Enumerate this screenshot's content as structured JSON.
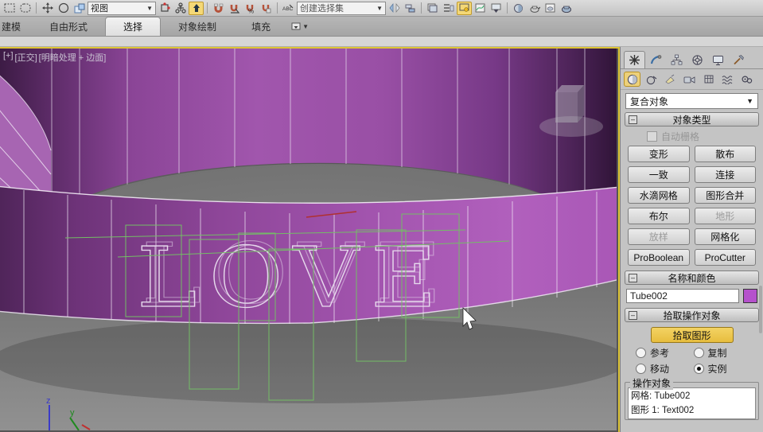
{
  "toolbar": {
    "view_dropdown": "视图",
    "selection_set_placeholder": "创建选择集"
  },
  "ribbon": {
    "tabs": [
      {
        "label": "建模"
      },
      {
        "label": "自由形式"
      },
      {
        "label": "选择",
        "active": true
      },
      {
        "label": "对象绘制"
      },
      {
        "label": "填充"
      }
    ]
  },
  "viewport": {
    "label_general": "[+]",
    "label_pov": "[正交]",
    "label_shading": "[明暗处理 + 边面]",
    "love_text": "LOVE",
    "axis_z": "z",
    "axis_y": "y",
    "colors": {
      "tube_purple": "#9b51a8",
      "shape_green": "#74b868",
      "border_yellow": "#ddc435"
    }
  },
  "panel": {
    "category_dropdown": "复合对象",
    "object_type": {
      "title": "对象类型",
      "autogrid_label": "自动栅格",
      "buttons": [
        {
          "label": "变形"
        },
        {
          "label": "散布"
        },
        {
          "label": "一致"
        },
        {
          "label": "连接"
        },
        {
          "label": "水滴网格"
        },
        {
          "label": "图形合并"
        },
        {
          "label": "布尔"
        },
        {
          "label": "地形",
          "disabled": true
        },
        {
          "label": "放样",
          "disabled": true
        },
        {
          "label": "网格化"
        },
        {
          "label": "ProBoolean"
        },
        {
          "label": "ProCutter"
        }
      ]
    },
    "name_color": {
      "title": "名称和颜色",
      "name_value": "Tube002",
      "swatch_color": "#b551cc"
    },
    "pick": {
      "title": "拾取操作对象",
      "pick_button": "拾取图形",
      "radio_reference": "参考",
      "radio_copy": "复制",
      "radio_move": "移动",
      "radio_instance": "实例",
      "selected": "实例"
    },
    "operands": {
      "title": "操作对象",
      "items": [
        "网格: Tube002",
        "图形 1: Text002"
      ]
    }
  }
}
